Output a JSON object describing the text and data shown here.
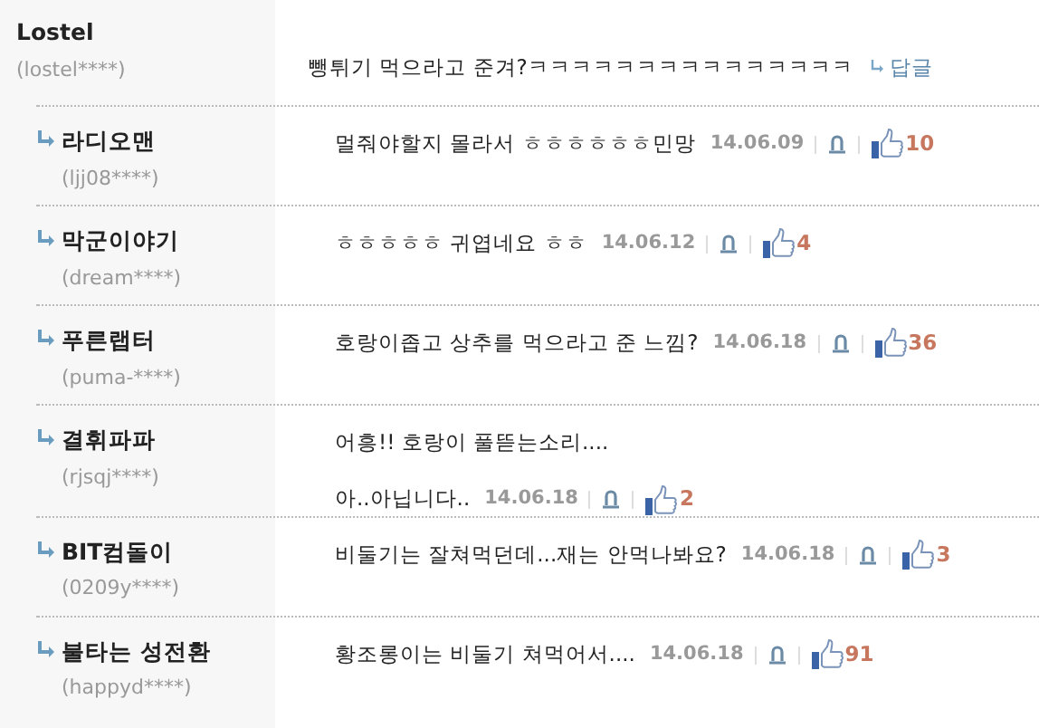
{
  "comment": {
    "author": "Lostel",
    "user_id": "(lostel****)",
    "body": "뺑튀기 먹으라고 준겨?ㅋㅋㅋㅋㅋㅋㅋㅋㅋㅋㅋㅋㅋㅋㅋ",
    "reply_link": "답글"
  },
  "replies": [
    {
      "author": "라디오맨",
      "user_id": "(ljj08****)",
      "body": [
        "멀줘야할지 몰라서 ㅎㅎㅎㅎㅎㅎ민망"
      ],
      "date": "14.06.09",
      "likes": "10"
    },
    {
      "author": "막군이야기",
      "user_id": "(dream****)",
      "body": [
        "ㅎㅎㅎㅎㅎ 귀엽네요 ㅎㅎ"
      ],
      "date": "14.06.12",
      "likes": "4"
    },
    {
      "author": "푸른랩터",
      "user_id": "(puma-****)",
      "body": [
        "호랑이좁고 상추를 먹으라고 준 느낌?"
      ],
      "date": "14.06.18",
      "likes": "36"
    },
    {
      "author": "결휘파파",
      "user_id": "(rjsqj****)",
      "body": [
        "어흥!! 호랑이 풀뜯는소리....",
        "아..아닙니다.."
      ],
      "date": "14.06.18",
      "likes": "2"
    },
    {
      "author": "BIT컴돌이",
      "user_id": "(0209y****)",
      "body": [
        "비둘기는 잘쳐먹던데...재는 안먹나봐요?"
      ],
      "date": "14.06.18",
      "likes": "3"
    },
    {
      "author": "불타는 성전환",
      "user_id": "(happyd****)",
      "body": [
        "황조롱이는 비둘기 쳐먹어서...."
      ],
      "date": "14.06.18",
      "likes": "91"
    }
  ]
}
